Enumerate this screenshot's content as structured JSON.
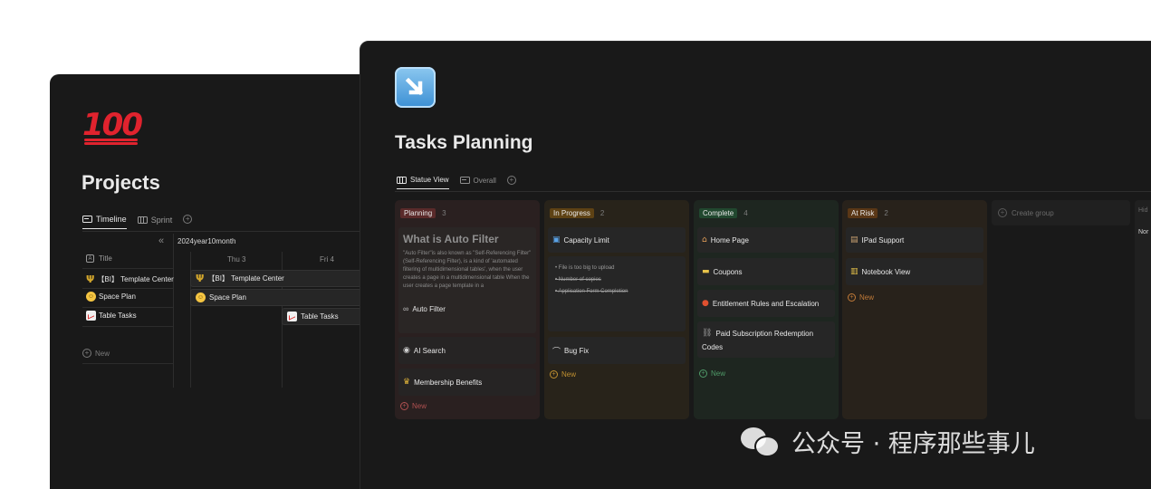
{
  "projects_window": {
    "title": "Projects",
    "tabs": [
      {
        "label": "Timeline"
      },
      {
        "label": "Sprint"
      }
    ],
    "month": "2024year10month",
    "days": [
      "Thu 3",
      "Fri 4"
    ],
    "title_column": "Title",
    "rows": [
      {
        "label": "【BI】 Template Center",
        "icon": "trident-icon"
      },
      {
        "label": "Space Plan",
        "icon": "smile-icon"
      },
      {
        "label": "Table Tasks",
        "icon": "chart-icon"
      }
    ],
    "bars": [
      {
        "label": "【BI】 Template Center"
      },
      {
        "label": "Space Plan"
      },
      {
        "label": "Table Tasks"
      }
    ],
    "new_label": "New"
  },
  "tasks_window": {
    "title": "Tasks Planning",
    "tabs": [
      {
        "label": "Statue View"
      },
      {
        "label": "Overall"
      }
    ],
    "columns": [
      {
        "name": "Planning",
        "count": "3",
        "feature": {
          "title": "What is Auto Filter",
          "desc": "\"Auto Filter\"is also known as \"Self-Referencing Filter\" (Self-Referencing Filter), is a kind of 'automated filtering of multidimensional tables', when the user creates a page in a multidimensional table When the user creates a page template in a",
          "link": "Auto Filter"
        },
        "cards": [
          "AI Search",
          "Membership Benefits"
        ],
        "new_label": "New"
      },
      {
        "name": "In Progress",
        "count": "2",
        "cards": [
          "Capacity Limit",
          "Bug Fix"
        ],
        "checklist": [
          "File is too big to upload",
          "Number of copies",
          "Application Form Completion"
        ],
        "new_label": "New"
      },
      {
        "name": "Complete",
        "count": "4",
        "cards": [
          "Home Page",
          "Coupons",
          "Entitlement Rules and Escalation",
          "Paid Subscription Redemption",
          "Codes"
        ],
        "new_label": "New"
      },
      {
        "name": "At Risk",
        "count": "2",
        "cards": [
          "IPad Support",
          "Notebook View"
        ],
        "new_label": "New"
      }
    ],
    "create_group": "Create group",
    "hidden_label": "Hid",
    "hidden_item": "Nor"
  },
  "watermark": "公众号 · 程序那些事儿",
  "colors": {
    "background": "#191919",
    "planning": "#5a2a2a",
    "in_progress": "#5e4214",
    "complete": "#21482f",
    "at_risk": "#5a3716"
  }
}
